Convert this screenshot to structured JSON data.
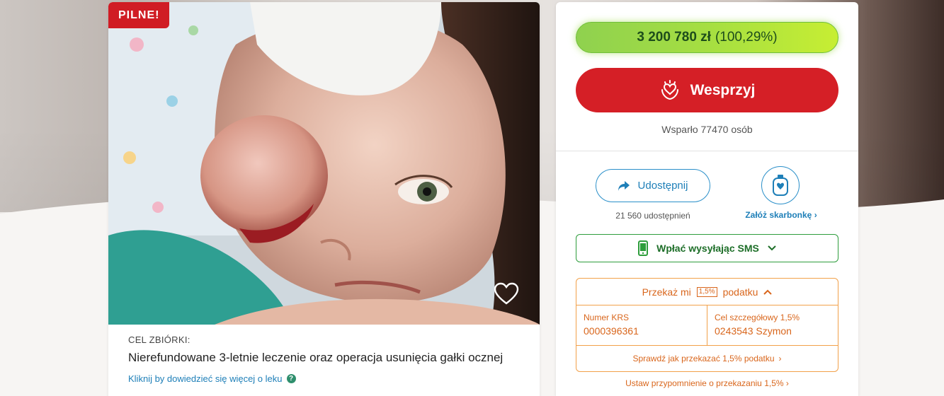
{
  "photo": {
    "badge": "PILNE!"
  },
  "goal": {
    "label": "CEL ZBIÓRKI:",
    "title": "Nierefundowane 3-letnie leczenie oraz operacja usunięcia gałki ocznej",
    "more_link": "Kliknij by dowiedzieć się więcej o leku",
    "help_glyph": "?"
  },
  "fundraiser": {
    "amount": "3 200 780 zł",
    "percent": "(100,29%)",
    "donate_label": "Wesprzyj",
    "supporters": "Wsparło 77470 osób",
    "share_label": "Udostępnij",
    "share_count": "21 560 udostępnień",
    "piggy_label": "Załóż skarbonkę",
    "sms_label": "Wpłać wysyłając SMS"
  },
  "tax": {
    "head_before": "Przekaż mi",
    "head_pct": "1,5%",
    "head_after": "podatku",
    "krs_label": "Numer KRS",
    "krs_value": "0000396361",
    "goal_label": "Cel szczegółowy 1,5%",
    "goal_value": "0243543 Szymon",
    "howto_link": "Sprawdź jak przekazać 1,5% podatku",
    "reminder_link": "Ustaw przypomnienie o przekazaniu 1,5%"
  },
  "colors": {
    "urgent_red": "#d01c24",
    "donate_red": "#d51f26",
    "progress_green": "#a8e040",
    "link_blue": "#1e7fb8",
    "sms_green": "#2e9d3c",
    "tax_orange": "#d9661c"
  },
  "icons": {
    "donate": "heart-hand-icon",
    "share": "share-arrow-icon",
    "piggy": "piggy-bank-icon",
    "sms": "phone-icon",
    "favorite": "heart-outline-icon"
  }
}
